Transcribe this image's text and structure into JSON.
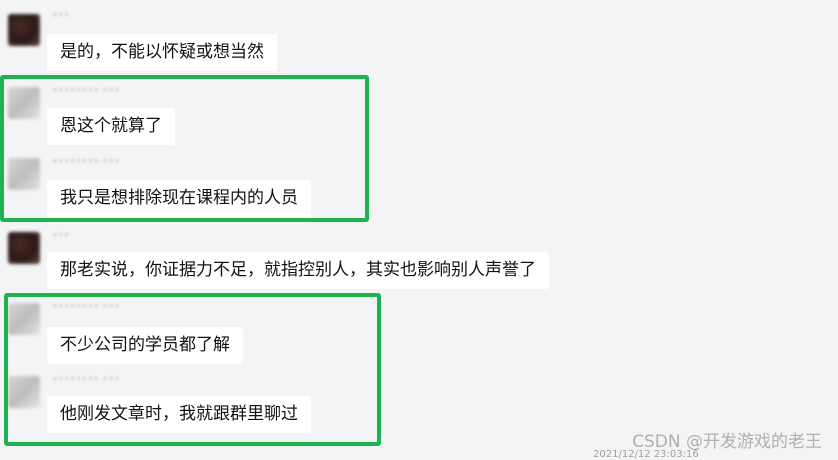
{
  "messages": [
    {
      "sender_name": "•••",
      "text": "是的，不能以怀疑或想当然"
    },
    {
      "sender_name": "•••••••• •••",
      "text": "恩这个就算了"
    },
    {
      "sender_name": "•••••••• •••",
      "text": "我只是想排除现在课程内的人员"
    },
    {
      "sender_name": "•••",
      "text": "那老实说，你证据力不足，就指控别人，其实也影响别人声誉了"
    },
    {
      "sender_name": "•••••••• •••",
      "text": "不少公司的学员都了解"
    },
    {
      "sender_name": "•••••••• •••",
      "text": "他刚发文章时，我就跟群里聊过"
    }
  ],
  "highlight_color": "#20b24f",
  "bubble_color": "#ffffff",
  "background_color": "#f3f4f6",
  "watermark": "CSDN @开发游戏的老王",
  "timestamp": "2021/12/12 23:03:16"
}
